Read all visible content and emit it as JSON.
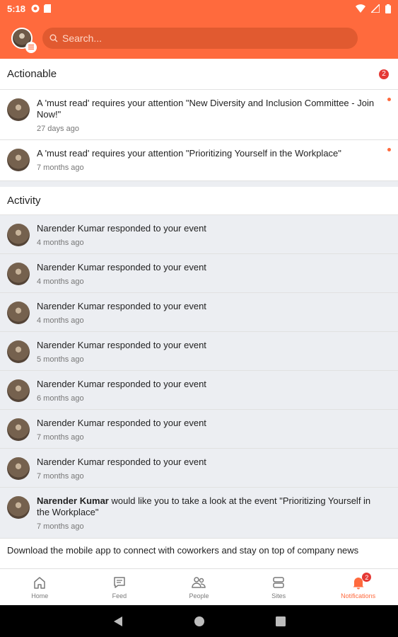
{
  "status_bar": {
    "time": "5:18"
  },
  "header": {
    "search_placeholder": "Search..."
  },
  "actionable": {
    "title": "Actionable",
    "count": "2",
    "items": [
      {
        "text": "A 'must read' requires your attention \"New Diversity and Inclusion Committee - Join Now!\"",
        "time": "27 days ago"
      },
      {
        "text": "A 'must read' requires your attention \"Prioritizing Yourself in the Workplace\"",
        "time": "7 months ago"
      }
    ]
  },
  "activity": {
    "title": "Activity",
    "items": [
      {
        "text": "Narender Kumar responded to your event",
        "time": "4 months ago"
      },
      {
        "text": "Narender Kumar responded to your event",
        "time": "4 months ago"
      },
      {
        "text": "Narender Kumar responded to your event",
        "time": "4 months ago"
      },
      {
        "text": "Narender Kumar responded to your event",
        "time": "5 months ago"
      },
      {
        "text": "Narender Kumar responded to your event",
        "time": "6 months ago"
      },
      {
        "text": "Narender Kumar responded to your event",
        "time": "7 months ago"
      },
      {
        "text": "Narender Kumar responded to your event",
        "time": "7 months ago"
      }
    ],
    "last_item": {
      "name": "Narender Kumar",
      "text": "would like you to take a look at the event \"Prioritizing Yourself in the Workplace\"",
      "time": "7 months ago"
    }
  },
  "banner": {
    "text": "Download the mobile app to connect with coworkers and stay on top of company news"
  },
  "bottom_nav": {
    "items": [
      {
        "label": "Home",
        "icon": "home-icon"
      },
      {
        "label": "Feed",
        "icon": "feed-icon"
      },
      {
        "label": "People",
        "icon": "people-icon"
      },
      {
        "label": "Sites",
        "icon": "sites-icon"
      },
      {
        "label": "Notifications",
        "icon": "bell-icon",
        "badge": "2"
      }
    ]
  },
  "colors": {
    "accent": "#ff6a3d",
    "badge": "#e53935"
  }
}
